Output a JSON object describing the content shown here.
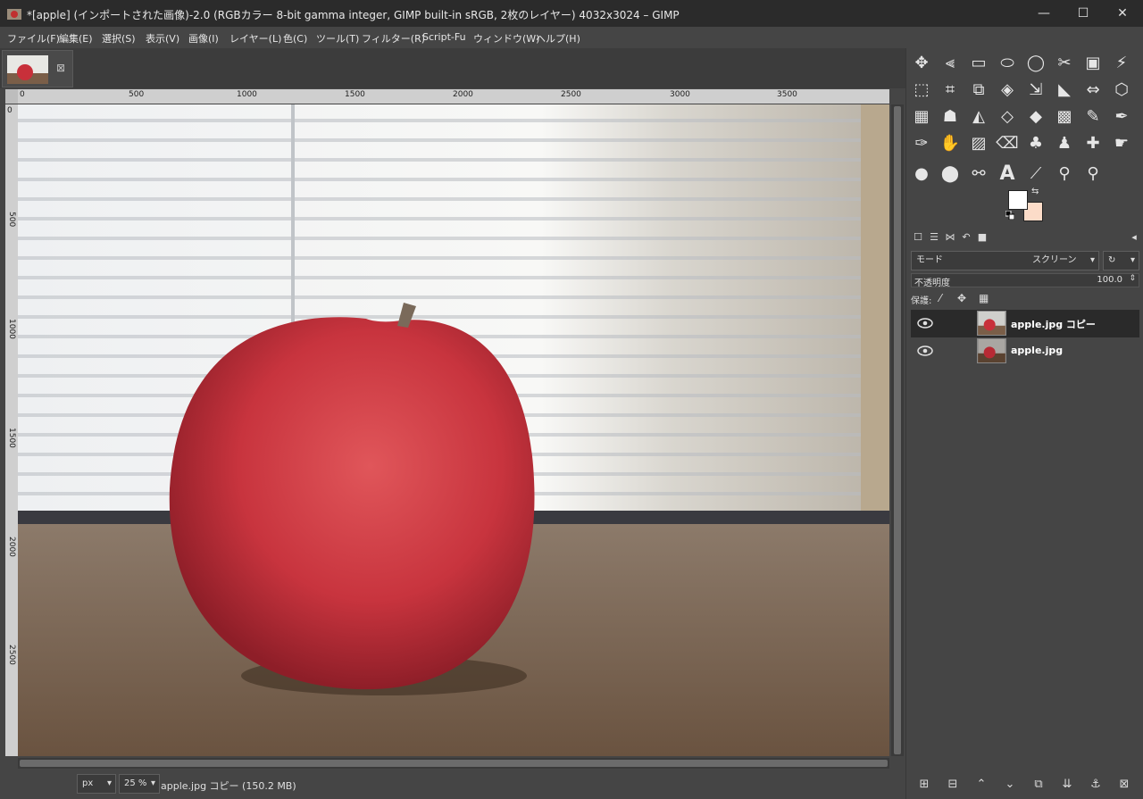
{
  "window": {
    "title": "*[apple] (インポートされた画像)-2.0 (RGBカラー 8-bit gamma integer, GIMP built-in sRGB, 2枚のレイヤー) 4032x3024 – GIMP",
    "controls": [
      "minimize",
      "maximize",
      "close"
    ]
  },
  "menu": [
    "ファイル(F)",
    "編集(E)",
    "選択(S)",
    "表示(V)",
    "画像(I)",
    "レイヤー(L)",
    "色(C)",
    "ツール(T)",
    "フィルター(R)",
    "Script-Fu",
    "ウィンドウ(W)",
    "ヘルプ(H)"
  ],
  "ruler": {
    "top_labels": [
      "0",
      "500",
      "1000",
      "1500",
      "2000",
      "2500",
      "3000",
      "3500"
    ],
    "left_labels": [
      "0",
      "500",
      "1000",
      "1500",
      "2000",
      "2500"
    ]
  },
  "status": {
    "unit": "px",
    "zoom": "25 %",
    "text": "apple.jpg コピー (150.2 MB)"
  },
  "colors": {
    "foreground": "#ffffff",
    "background": "#fcdcc8"
  },
  "layers_panel": {
    "mode_label": "モード",
    "mode_value": "スクリーン",
    "opacity_label": "不透明度",
    "opacity_value": "100.0",
    "lock_label": "保護:",
    "layers": [
      {
        "name": "apple.jpg コピー",
        "visible": true,
        "selected": true
      },
      {
        "name": "apple.jpg",
        "visible": true,
        "selected": false
      }
    ]
  },
  "tools": [
    "move-icon",
    "align-icon",
    "rect-select-icon",
    "ellipse-select-icon",
    "free-select-icon",
    "scissors-select-icon",
    "foreground-select-icon",
    "fuzzy-select-icon",
    "select-by-color-icon",
    "crop-icon",
    "unified-transform-icon",
    "rotate-icon",
    "scale-icon",
    "shear-icon",
    "flip-icon",
    "perspective-icon",
    "cage-icon",
    "warp-icon",
    "handle-transform-icon",
    "bucket-fill-icon",
    "gradient-icon",
    "paintbrush-icon",
    "pencil-icon",
    "airbrush-icon",
    "ink-icon",
    "mypaint-brush-icon",
    "eraser-icon",
    "clone-icon",
    "perspective-clone-icon",
    "heal-icon",
    "smudge-icon",
    "blur-icon",
    "dodge-icon",
    "paths-icon",
    "text-icon",
    "color-picker-icon",
    "measure-icon",
    "zoom-icon"
  ]
}
